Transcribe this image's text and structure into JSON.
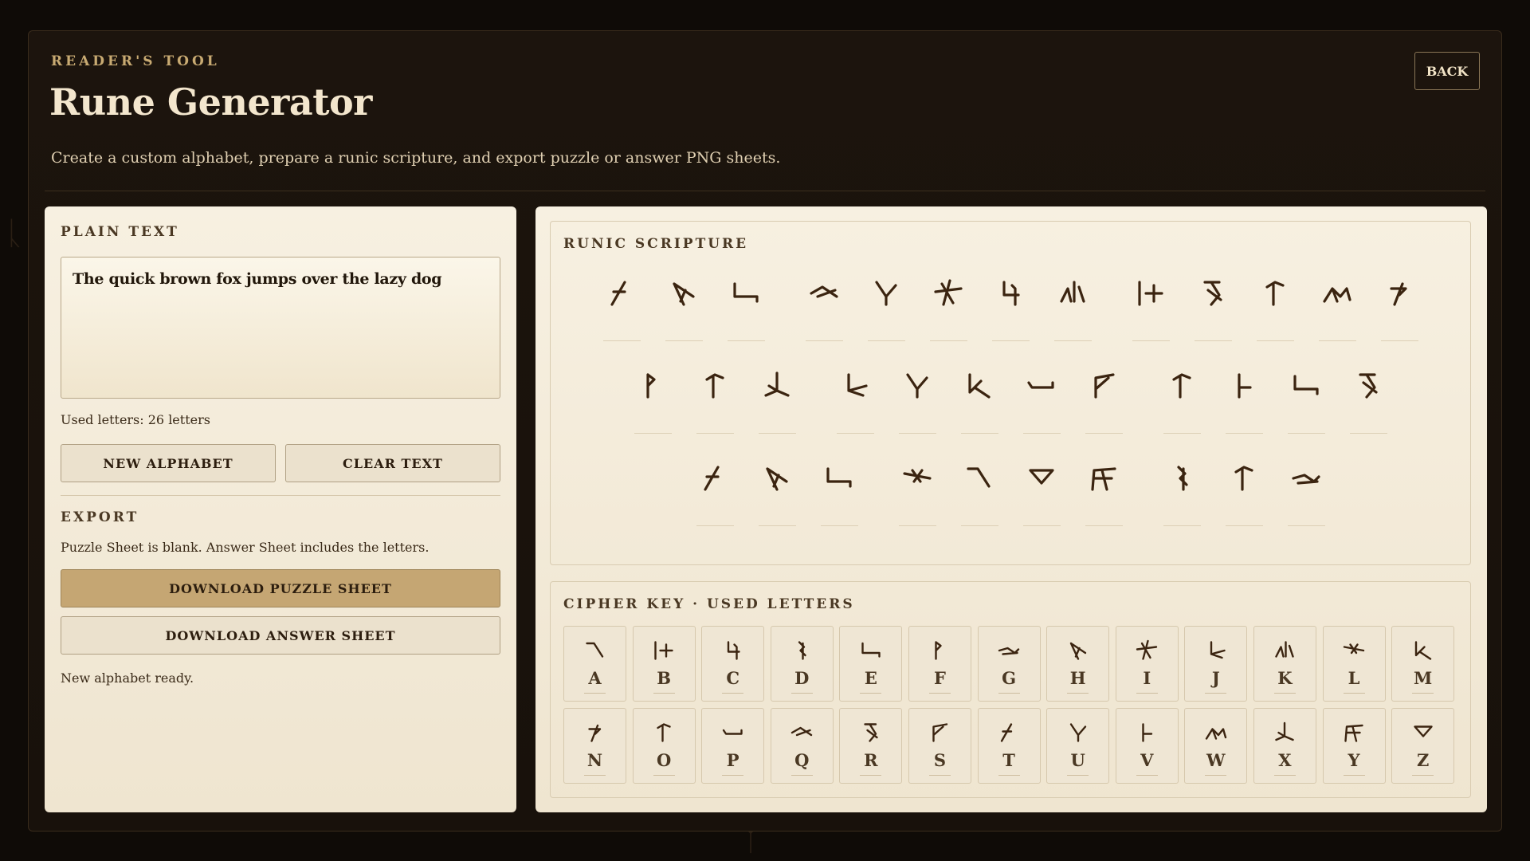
{
  "header": {
    "eyebrow": "READER'S TOOL",
    "title": "Rune Generator",
    "subtitle": "Create a custom alphabet, prepare a runic scripture, and export puzzle or answer PNG sheets.",
    "back_label": "BACK"
  },
  "left": {
    "plain_label": "PLAIN TEXT",
    "plain_text_value": "The quick brown fox jumps over the lazy dog",
    "used_letters": "Used letters: 26 letters",
    "new_alphabet_label": "NEW ALPHABET",
    "clear_text_label": "CLEAR TEXT",
    "export_label": "EXPORT",
    "export_note": "Puzzle Sheet is blank. Answer Sheet includes the letters.",
    "download_puzzle_label": "DOWNLOAD PUZZLE SHEET",
    "download_answer_label": "DOWNLOAD ANSWER SHEET",
    "status": "New alphabet ready."
  },
  "right": {
    "scripture_label": "RUNIC SCRIPTURE",
    "key_label": "CIPHER KEY  ·  USED LETTERS",
    "scripture_rows": [
      [
        "T",
        "H",
        "E",
        " ",
        "Q",
        "U",
        "I",
        "C",
        "K",
        " ",
        "B",
        "R",
        "O",
        "W",
        "N"
      ],
      [
        "F",
        "O",
        "X",
        " ",
        "J",
        "U",
        "M",
        "P",
        "S",
        " ",
        "O",
        "V",
        "E",
        "R"
      ],
      [
        "T",
        "H",
        "E",
        " ",
        "L",
        "A",
        "Z",
        "Y",
        " ",
        "D",
        "O",
        "G"
      ]
    ],
    "letters": [
      "A",
      "B",
      "C",
      "D",
      "E",
      "F",
      "G",
      "H",
      "I",
      "J",
      "K",
      "L",
      "M",
      "N",
      "O",
      "P",
      "Q",
      "R",
      "S",
      "T",
      "U",
      "V",
      "W",
      "X",
      "Y",
      "Z"
    ]
  },
  "colors": {
    "background": "#0f0b07",
    "panel": "#f7f0e1",
    "accent_button": "#c5a673",
    "rune_ink": "#3b2410",
    "title": "#f3e6cd"
  }
}
